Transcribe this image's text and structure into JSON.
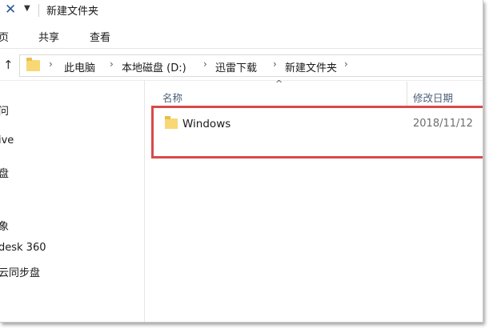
{
  "window": {
    "title": "新建文件夹"
  },
  "ribbon": {
    "tabs": [
      "页",
      "共享",
      "查看"
    ]
  },
  "address": {
    "breadcrumbs": [
      "此电脑",
      "本地磁盘 (D:)",
      "迅雷下载",
      "新建文件夹"
    ]
  },
  "nav_pane": {
    "items": [
      "问",
      "ive",
      "盘",
      "象",
      "desk 360",
      "云同步盘"
    ]
  },
  "columns": {
    "name": "名称",
    "modified": "修改日期"
  },
  "files": [
    {
      "name": "Windows",
      "modified": "2018/11/12"
    }
  ],
  "colors": {
    "highlight": "#d84a4a",
    "folder": "#f8d775",
    "column_header": "#4c607a"
  },
  "icons": [
    "close-icon",
    "quick-access-arrow-icon",
    "up-arrow-icon",
    "folder-icon",
    "chevron-right-icon",
    "sort-up-icon"
  ]
}
